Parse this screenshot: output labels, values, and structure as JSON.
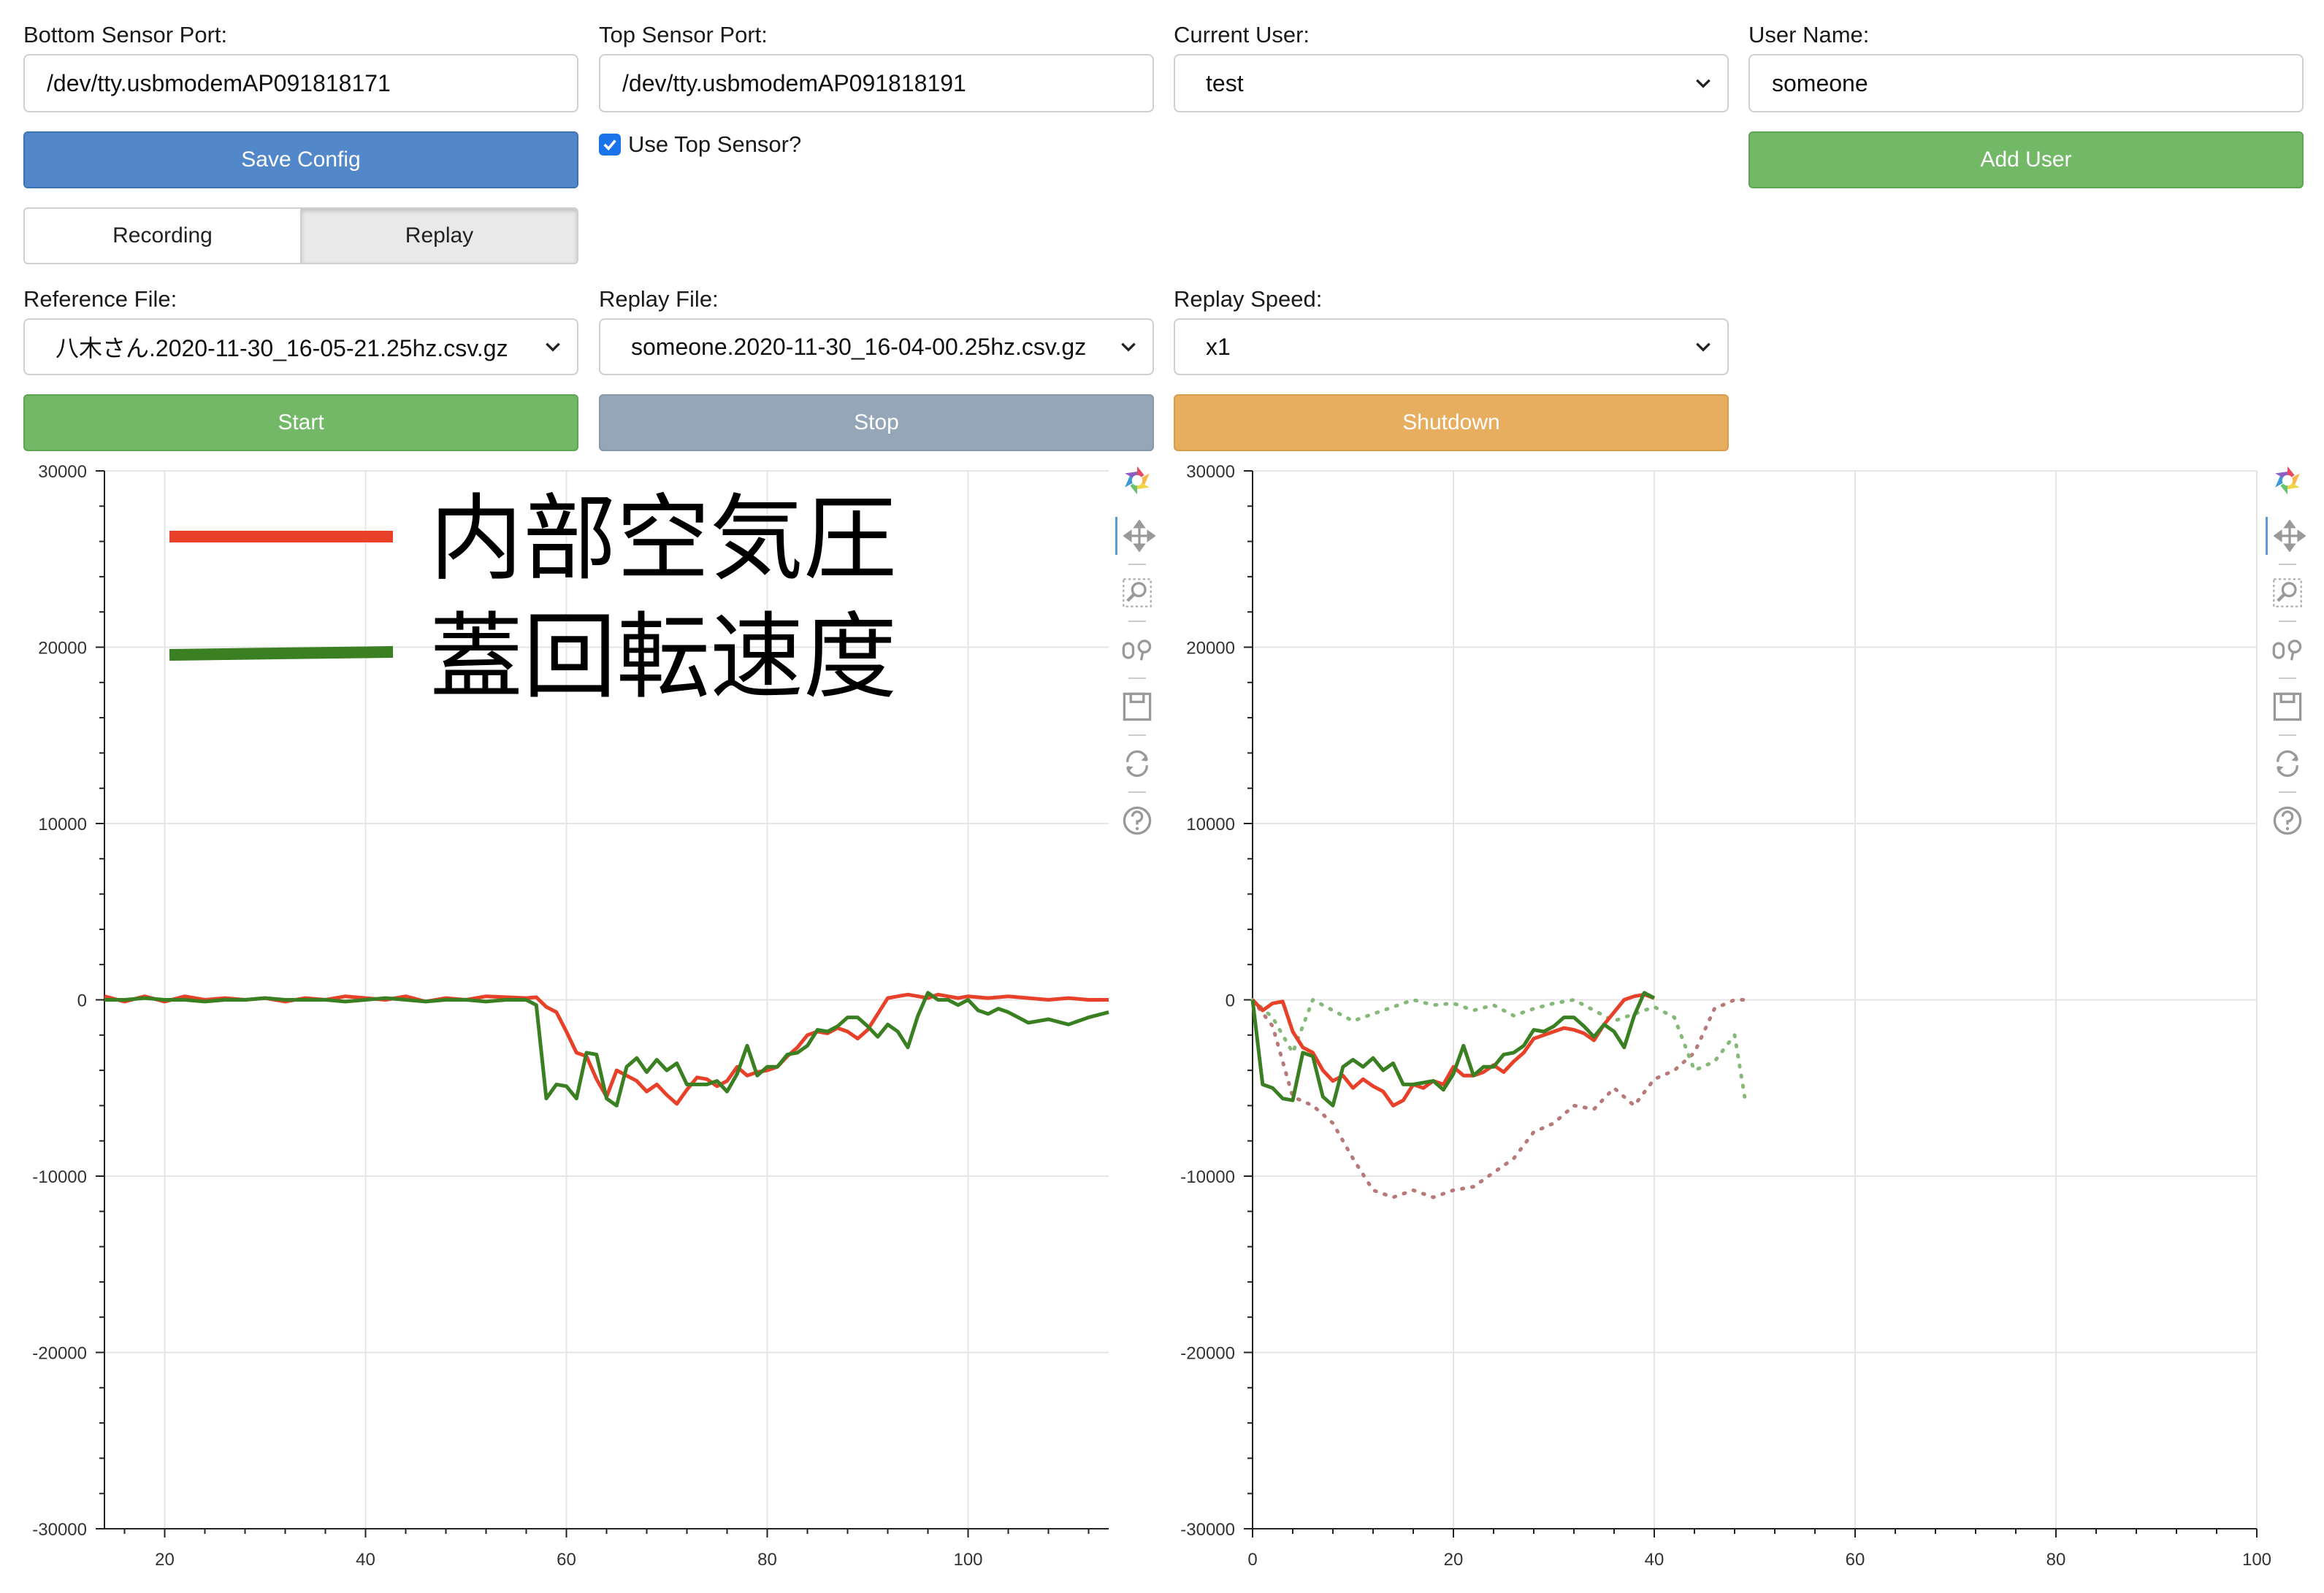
{
  "config": {
    "bottom_sensor_label": "Bottom Sensor Port:",
    "bottom_sensor_value": "/dev/tty.usbmodemAP091818171",
    "top_sensor_label": "Top Sensor Port:",
    "top_sensor_value": "/dev/tty.usbmodemAP091818191",
    "current_user_label": "Current User:",
    "current_user_value": "test",
    "user_name_label": "User Name:",
    "user_name_value": "someone",
    "save_config": "Save Config",
    "use_top_sensor": "Use Top Sensor?",
    "use_top_sensor_checked": true,
    "add_user": "Add User"
  },
  "mode": {
    "recording": "Recording",
    "replay": "Replay",
    "active": "Replay"
  },
  "replay": {
    "reference_label": "Reference File:",
    "reference_value": "八木さん.2020-11-30_16-05-21.25hz.csv.gz",
    "replay_file_label": "Replay File:",
    "replay_file_value": "someone.2020-11-30_16-04-00.25hz.csv.gz",
    "speed_label": "Replay Speed:",
    "speed_value": "x1"
  },
  "actions": {
    "start": "Start",
    "stop": "Stop",
    "shutdown": "Shutdown"
  },
  "colors": {
    "blue": "#5288c9",
    "green_btn": "#73b866",
    "grey_btn": "#94a6b8",
    "orange_btn": "#e7ae60",
    "pressure": "#e8412a",
    "rotation": "#3a7f22",
    "ref_pressure": "#b87a78",
    "ref_rotation": "#86b87a"
  },
  "toolbar_icons": [
    "bokeh-logo-icon",
    "pan-icon",
    "box-zoom-icon",
    "wheel-zoom-icon",
    "save-icon",
    "reset-icon",
    "help-icon"
  ],
  "chart_data": [
    {
      "type": "line",
      "xlim": [
        14,
        114
      ],
      "ylim": [
        -30000,
        30000
      ],
      "x_ticks": [
        20,
        40,
        60,
        80,
        100
      ],
      "y_ticks": [
        30000,
        20000,
        10000,
        0,
        -10000,
        -20000,
        -30000
      ],
      "grid": true,
      "legend_position": "top-left",
      "legend_entries": [
        "内部空気圧",
        "蓋回転速度"
      ],
      "series": [
        {
          "name": "内部空気圧",
          "style": "solid",
          "color": "#e8412a",
          "x": [
            14,
            16,
            18,
            20,
            22,
            24,
            26,
            28,
            30,
            32,
            34,
            36,
            38,
            40,
            42,
            44,
            46,
            48,
            50,
            52,
            54,
            56,
            57,
            58,
            59,
            60,
            61,
            62,
            63,
            64,
            65,
            66,
            67,
            68,
            69,
            70,
            71,
            72,
            73,
            74,
            75,
            76,
            77,
            78,
            79,
            80,
            81,
            82,
            83,
            84,
            85,
            86,
            87,
            88,
            89,
            90,
            91,
            92,
            93,
            94,
            95,
            96,
            97,
            98,
            99,
            100,
            102,
            104,
            106,
            108,
            110,
            112,
            114
          ],
          "y": [
            200,
            -100,
            200,
            -100,
            200,
            0,
            100,
            0,
            100,
            -100,
            100,
            0,
            200,
            100,
            0,
            200,
            -100,
            100,
            0,
            200,
            150,
            100,
            150,
            -400,
            -700,
            -1800,
            -3000,
            -3200,
            -4500,
            -5500,
            -4000,
            -4300,
            -4600,
            -5200,
            -4800,
            -5400,
            -5900,
            -5100,
            -4400,
            -4500,
            -4900,
            -4600,
            -3800,
            -4300,
            -4100,
            -4000,
            -3800,
            -3200,
            -2700,
            -2000,
            -1800,
            -1900,
            -1600,
            -1800,
            -2200,
            -1700,
            -800,
            100,
            200,
            300,
            200,
            100,
            300,
            200,
            100,
            200,
            100,
            200,
            100,
            0,
            100,
            0,
            0
          ]
        },
        {
          "name": "蓋回転速度",
          "style": "solid",
          "color": "#3a7f22",
          "x": [
            14,
            16,
            18,
            20,
            22,
            24,
            26,
            28,
            30,
            32,
            34,
            36,
            38,
            40,
            42,
            44,
            46,
            48,
            50,
            52,
            54,
            56,
            57,
            58,
            59,
            60,
            61,
            62,
            63,
            64,
            65,
            66,
            67,
            68,
            69,
            70,
            71,
            72,
            73,
            74,
            75,
            76,
            77,
            78,
            79,
            80,
            81,
            82,
            83,
            84,
            85,
            86,
            87,
            88,
            89,
            90,
            91,
            92,
            93,
            94,
            95,
            96,
            97,
            98,
            99,
            100,
            101,
            102,
            103,
            104,
            106,
            108,
            110,
            112,
            114
          ],
          "y": [
            0,
            0,
            100,
            0,
            0,
            -100,
            0,
            0,
            100,
            0,
            0,
            0,
            -100,
            0,
            100,
            0,
            -100,
            0,
            0,
            -100,
            0,
            0,
            -300,
            -5600,
            -4800,
            -4900,
            -5600,
            -3000,
            -3100,
            -5600,
            -6000,
            -3800,
            -3300,
            -4100,
            -3400,
            -4000,
            -3600,
            -4800,
            -4800,
            -4800,
            -4600,
            -5200,
            -4200,
            -2600,
            -4300,
            -3800,
            -3800,
            -3100,
            -3000,
            -2600,
            -1700,
            -1800,
            -1500,
            -1000,
            -1000,
            -1500,
            -2100,
            -1400,
            -1800,
            -2700,
            -900,
            400,
            0,
            0,
            -300,
            0,
            -600,
            -800,
            -500,
            -700,
            -1300,
            -1100,
            -1400,
            -1000,
            -700
          ]
        }
      ]
    },
    {
      "type": "line",
      "xlim": [
        0,
        100
      ],
      "ylim": [
        -30000,
        30000
      ],
      "x_ticks": [
        0,
        20,
        40,
        60,
        80,
        100
      ],
      "y_ticks": [
        30000,
        20000,
        10000,
        0,
        -10000,
        -20000,
        -30000
      ],
      "grid": true,
      "series": [
        {
          "style": "dotted",
          "color": "#b87a78",
          "x": [
            0,
            2,
            4,
            6,
            8,
            10,
            12,
            14,
            16,
            18,
            20,
            22,
            24,
            26,
            28,
            30,
            32,
            34,
            36,
            38,
            40,
            42,
            44,
            46,
            48,
            49
          ],
          "y": [
            0,
            -1500,
            -5500,
            -6000,
            -7000,
            -9000,
            -10800,
            -11200,
            -10800,
            -11200,
            -10800,
            -10600,
            -9800,
            -9000,
            -7500,
            -7000,
            -6000,
            -6200,
            -5000,
            -6000,
            -4500,
            -4000,
            -3000,
            -500,
            0,
            0
          ]
        },
        {
          "style": "dotted",
          "color": "#86b87a",
          "x": [
            0,
            2,
            4,
            6,
            8,
            10,
            12,
            14,
            16,
            18,
            20,
            22,
            24,
            26,
            28,
            30,
            32,
            34,
            36,
            38,
            40,
            42,
            44,
            46,
            48,
            49
          ],
          "y": [
            0,
            -1000,
            -3000,
            0,
            -600,
            -1200,
            -800,
            -400,
            0,
            -300,
            -200,
            -600,
            -300,
            -900,
            -500,
            -200,
            0,
            -600,
            -1200,
            -800,
            -400,
            -1000,
            -4000,
            -3500,
            -2000,
            -5500
          ]
        },
        {
          "style": "solid",
          "color": "#e8412a",
          "x": [
            0,
            1,
            2,
            3,
            4,
            5,
            6,
            7,
            8,
            9,
            10,
            11,
            12,
            13,
            14,
            15,
            16,
            17,
            18,
            19,
            20,
            21,
            22,
            23,
            24,
            25,
            26,
            27,
            28,
            29,
            30,
            31,
            32,
            33,
            34,
            35,
            36,
            37,
            38,
            39,
            40
          ],
          "y": [
            0,
            -600,
            -200,
            -100,
            -1800,
            -2700,
            -3000,
            -4000,
            -4600,
            -4300,
            -5000,
            -4500,
            -4900,
            -5200,
            -6000,
            -5700,
            -4800,
            -5000,
            -4600,
            -4800,
            -3800,
            -4300,
            -4300,
            -4100,
            -3700,
            -4100,
            -3500,
            -3000,
            -2200,
            -2000,
            -1800,
            -1600,
            -1700,
            -1900,
            -2300,
            -1400,
            -700,
            0,
            200,
            300,
            100
          ]
        },
        {
          "style": "solid",
          "color": "#3a7f22",
          "x": [
            0,
            1,
            2,
            3,
            4,
            5,
            6,
            7,
            8,
            9,
            10,
            11,
            12,
            13,
            14,
            15,
            16,
            17,
            18,
            19,
            20,
            21,
            22,
            23,
            24,
            25,
            26,
            27,
            28,
            29,
            30,
            31,
            32,
            33,
            34,
            35,
            36,
            37,
            38,
            39,
            40
          ],
          "y": [
            0,
            -4800,
            -5000,
            -5600,
            -5700,
            -3000,
            -3200,
            -5500,
            -6000,
            -3800,
            -3400,
            -3800,
            -3300,
            -4000,
            -3600,
            -4800,
            -4800,
            -4700,
            -4600,
            -5100,
            -4200,
            -2600,
            -4300,
            -3800,
            -3800,
            -3100,
            -3000,
            -2600,
            -1700,
            -1800,
            -1500,
            -1000,
            -1000,
            -1500,
            -2100,
            -1400,
            -1800,
            -2700,
            -900,
            400,
            100
          ]
        }
      ]
    }
  ]
}
